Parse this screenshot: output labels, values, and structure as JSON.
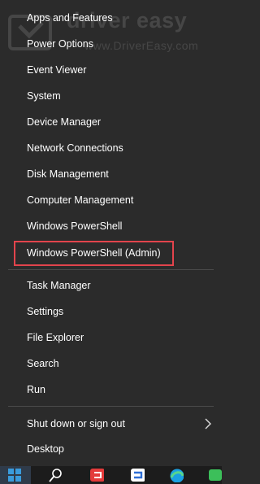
{
  "menu": {
    "items": [
      {
        "label": "Apps and Features"
      },
      {
        "label": "Power Options"
      },
      {
        "label": "Event Viewer"
      },
      {
        "label": "System"
      },
      {
        "label": "Device Manager"
      },
      {
        "label": "Network Connections"
      },
      {
        "label": "Disk Management"
      },
      {
        "label": "Computer Management"
      },
      {
        "label": "Windows PowerShell"
      },
      {
        "label": "Windows PowerShell (Admin)",
        "highlighted": true
      },
      {
        "label": "Task Manager"
      },
      {
        "label": "Settings"
      },
      {
        "label": "File Explorer"
      },
      {
        "label": "Search"
      },
      {
        "label": "Run"
      },
      {
        "label": "Shut down or sign out",
        "has_submenu": true
      },
      {
        "label": "Desktop"
      }
    ]
  },
  "watermark": {
    "brand": "driver easy",
    "url": "www.DriverEasy.com"
  },
  "taskbar": {
    "icons": [
      "windows-start-icon",
      "search-icon",
      "app-icon-red",
      "app-icon-blue",
      "edge-icon",
      "app-icon-extra"
    ]
  },
  "colors": {
    "menu_bg": "#2b2b2b",
    "highlight_border": "#e2444c",
    "taskbar_bg": "#1c1c1c"
  }
}
